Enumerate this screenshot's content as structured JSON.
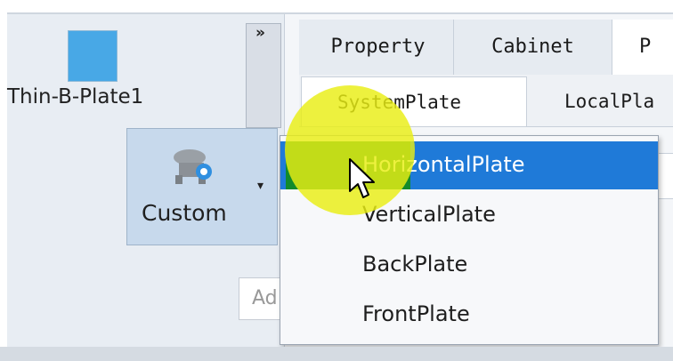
{
  "left_panel": {
    "item_label": "Thin-B-Plate1",
    "expand_label": "»",
    "custom_button": {
      "label": "Custom",
      "caret": "▾"
    },
    "add_button_label": "Ad"
  },
  "tabs_primary": [
    "Property",
    "Cabinet",
    "P"
  ],
  "tabs_secondary": [
    "SystemPlate",
    "LocalPla"
  ],
  "dropdown": {
    "items": [
      "HorizontalPlate",
      "VerticalPlate",
      "BackPlate",
      "FrontPlate"
    ],
    "selected": "HorizontalPlate"
  },
  "colors": {
    "selection": "#1f7ad8",
    "thumbnail": "#48a8e6",
    "highlight": "#e9ee14"
  },
  "icons": [
    "double-chevron-right-icon",
    "custom-plate-icon",
    "dropdown-caret-icon",
    "mouse-cursor-icon"
  ]
}
